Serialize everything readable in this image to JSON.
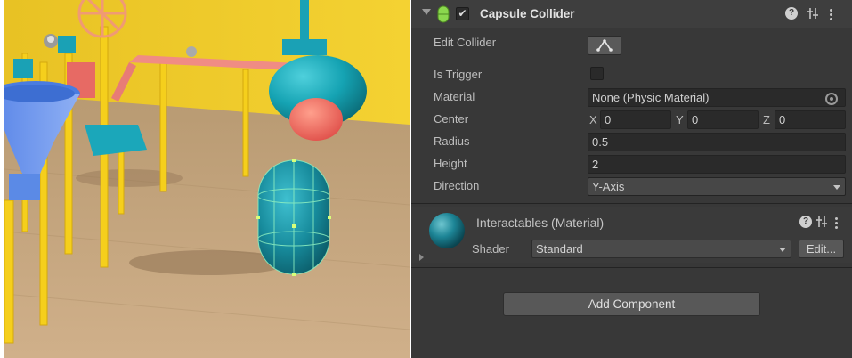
{
  "inspector": {
    "component": {
      "title": "Capsule Collider",
      "enabled_mark": "✔",
      "icons": [
        "help-icon",
        "preset-icon",
        "more-icon"
      ]
    },
    "fields": {
      "edit_collider_label": "Edit Collider",
      "is_trigger_label": "Is Trigger",
      "material_label": "Material",
      "material_value": "None (Physic Material)",
      "center_label": "Center",
      "center_x_label": "X",
      "center_x": "0",
      "center_y_label": "Y",
      "center_y": "0",
      "center_z_label": "Z",
      "center_z": "0",
      "radius_label": "Radius",
      "radius_value": "0.5",
      "height_label": "Height",
      "height_value": "2",
      "direction_label": "Direction",
      "direction_value": "Y-Axis"
    },
    "material": {
      "title": "Interactables (Material)",
      "shader_label": "Shader",
      "shader_value": "Standard",
      "edit_label": "Edit..."
    },
    "add_component_label": "Add Component"
  },
  "colors": {
    "inspector_bg": "#383838",
    "header_bg": "#3e3e3e",
    "field_bg": "#2a2a2a",
    "scene_wall": "#f2cf2c",
    "scene_floor": "#c9a87e",
    "capsule": "#1a94a6"
  }
}
